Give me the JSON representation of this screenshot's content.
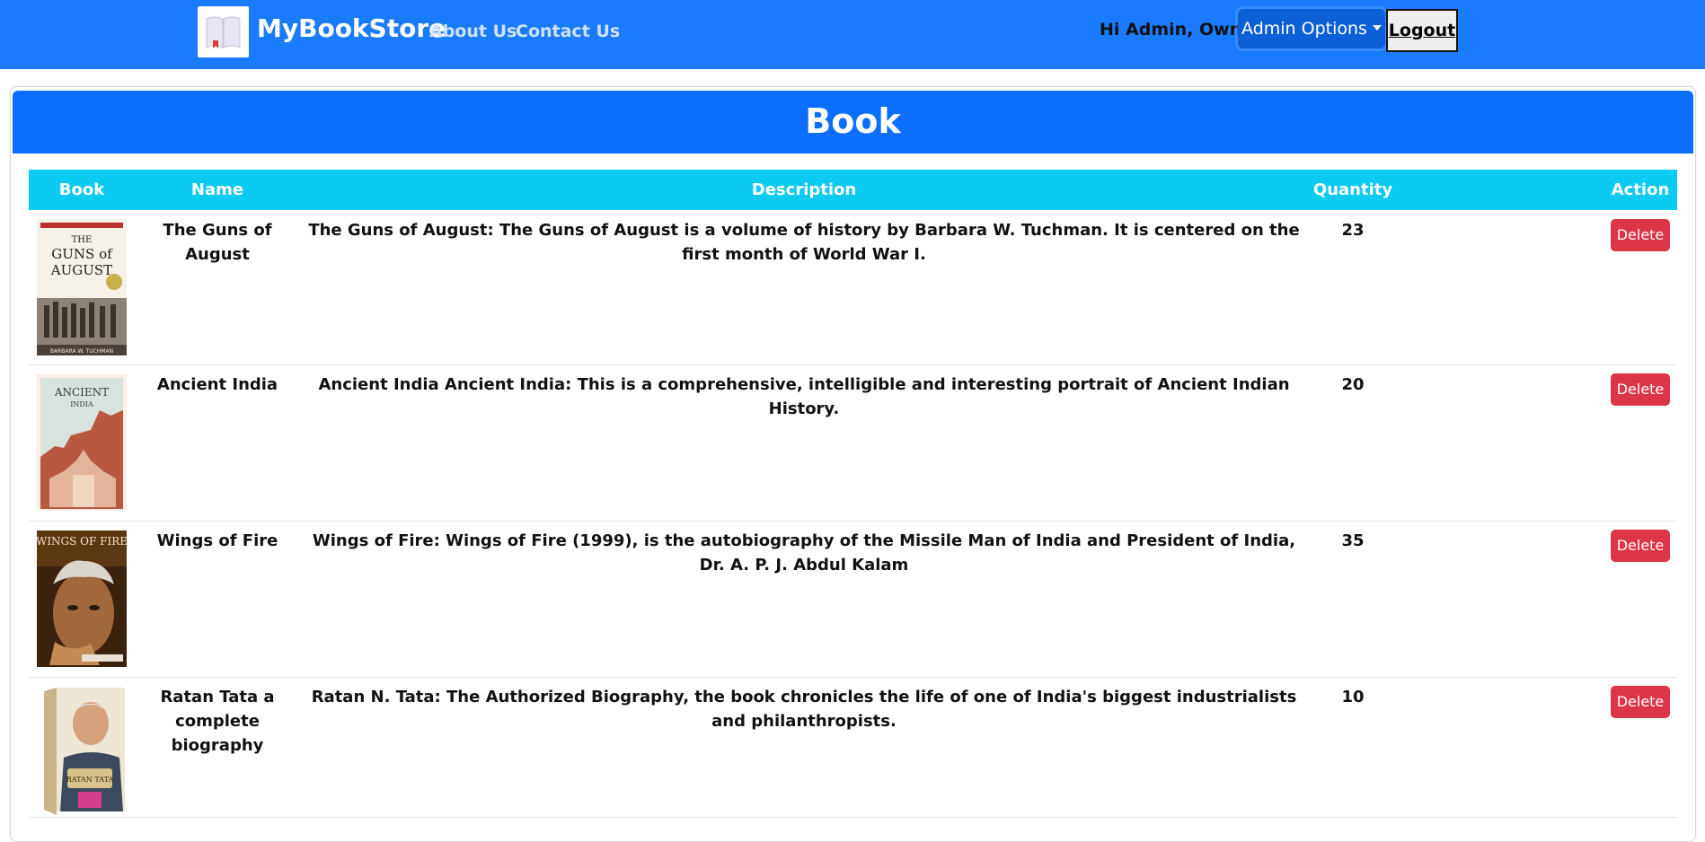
{
  "navbar": {
    "brand": "MyBookStore",
    "links": [
      "About Us",
      "Contact Us"
    ],
    "greeting": "Hi Admin, Owner",
    "admin_options": "Admin Options",
    "logout": "Logout"
  },
  "card": {
    "title": "Book"
  },
  "table": {
    "headers": [
      "Book",
      "Name",
      "Description",
      "Quantity",
      "Action"
    ],
    "rows": [
      {
        "name": "The Guns of August",
        "description": "The Guns of August: The Guns of August is a volume of history by Barbara W. Tuchman. It is centered on the first month of World War I.",
        "quantity": "23",
        "action": "Delete",
        "cover_title_1": "THE",
        "cover_title_2": "GUNS of",
        "cover_title_3": "AUGUST",
        "cover_author": "BARBARA W. TUCHMAN"
      },
      {
        "name": "Ancient India",
        "description": "Ancient India Ancient India: This is a comprehensive, intelligible and interesting portrait of Ancient Indian History.",
        "quantity": "20",
        "action": "Delete",
        "cover_title_1": "ANCIENT",
        "cover_title_2": "INDIA"
      },
      {
        "name": "Wings of Fire",
        "description": "Wings of Fire: Wings of Fire (1999), is the autobiography of the Missile Man of India and President of India, Dr. A. P. J. Abdul Kalam",
        "quantity": "35",
        "action": "Delete",
        "cover_title_1": "WINGS OF FIRE"
      },
      {
        "name": "Ratan Tata a complete biography",
        "description": "Ratan N. Tata: The Authorized Biography, the book chronicles the life of one of India's biggest industrialists and philanthropists.",
        "quantity": "10",
        "action": "Delete",
        "cover_title_1": "RATAN TATA"
      }
    ]
  },
  "colors": {
    "navbar": "#1a7bff",
    "header": "#0d6efd",
    "table_header": "#0dcaf0",
    "delete": "#dc3545"
  }
}
